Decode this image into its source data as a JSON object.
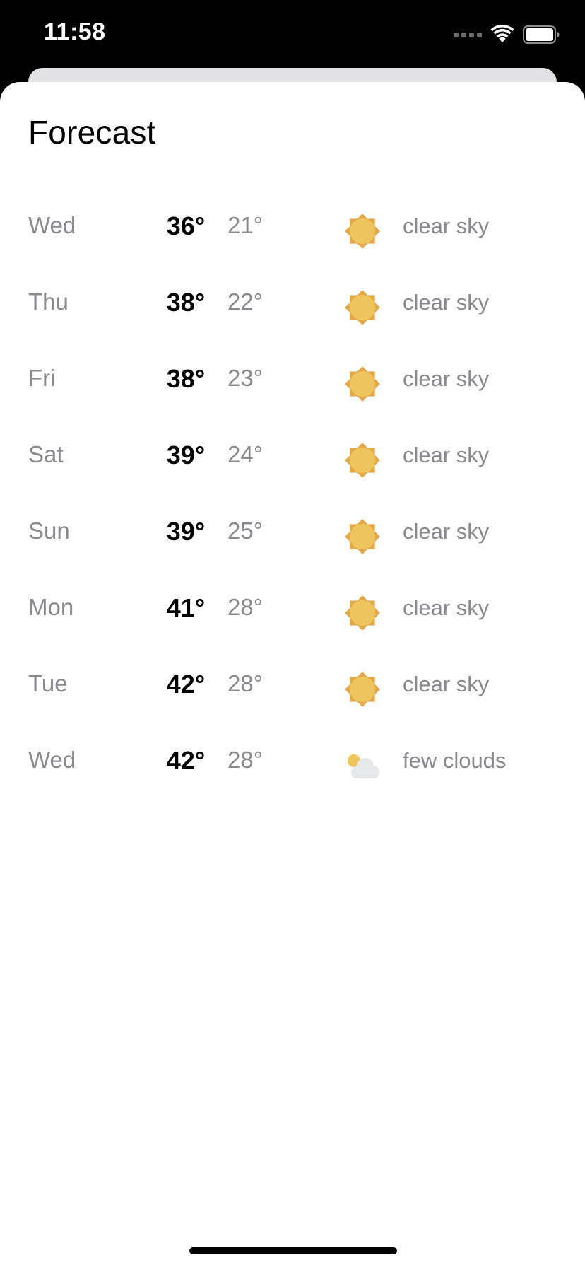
{
  "status_bar": {
    "time": "11:58"
  },
  "sheet": {
    "title": "Forecast"
  },
  "forecast": [
    {
      "day": "Wed",
      "high": "36°",
      "low": "21°",
      "icon": "sun-icon",
      "description": "clear sky"
    },
    {
      "day": "Thu",
      "high": "38°",
      "low": "22°",
      "icon": "sun-icon",
      "description": "clear sky"
    },
    {
      "day": "Fri",
      "high": "38°",
      "low": "23°",
      "icon": "sun-icon",
      "description": "clear sky"
    },
    {
      "day": "Sat",
      "high": "39°",
      "low": "24°",
      "icon": "sun-icon",
      "description": "clear sky"
    },
    {
      "day": "Sun",
      "high": "39°",
      "low": "25°",
      "icon": "sun-icon",
      "description": "clear sky"
    },
    {
      "day": "Mon",
      "high": "41°",
      "low": "28°",
      "icon": "sun-icon",
      "description": "clear sky"
    },
    {
      "day": "Tue",
      "high": "42°",
      "low": "28°",
      "icon": "sun-icon",
      "description": "clear sky"
    },
    {
      "day": "Wed",
      "high": "42°",
      "low": "28°",
      "icon": "partly-cloudy-icon",
      "description": "few clouds"
    }
  ],
  "colors": {
    "sun": "#f0c45c",
    "sun_rays": "#e2a84a",
    "cloud": "#e6e8ea",
    "muted_text": "#8a8a8e"
  }
}
